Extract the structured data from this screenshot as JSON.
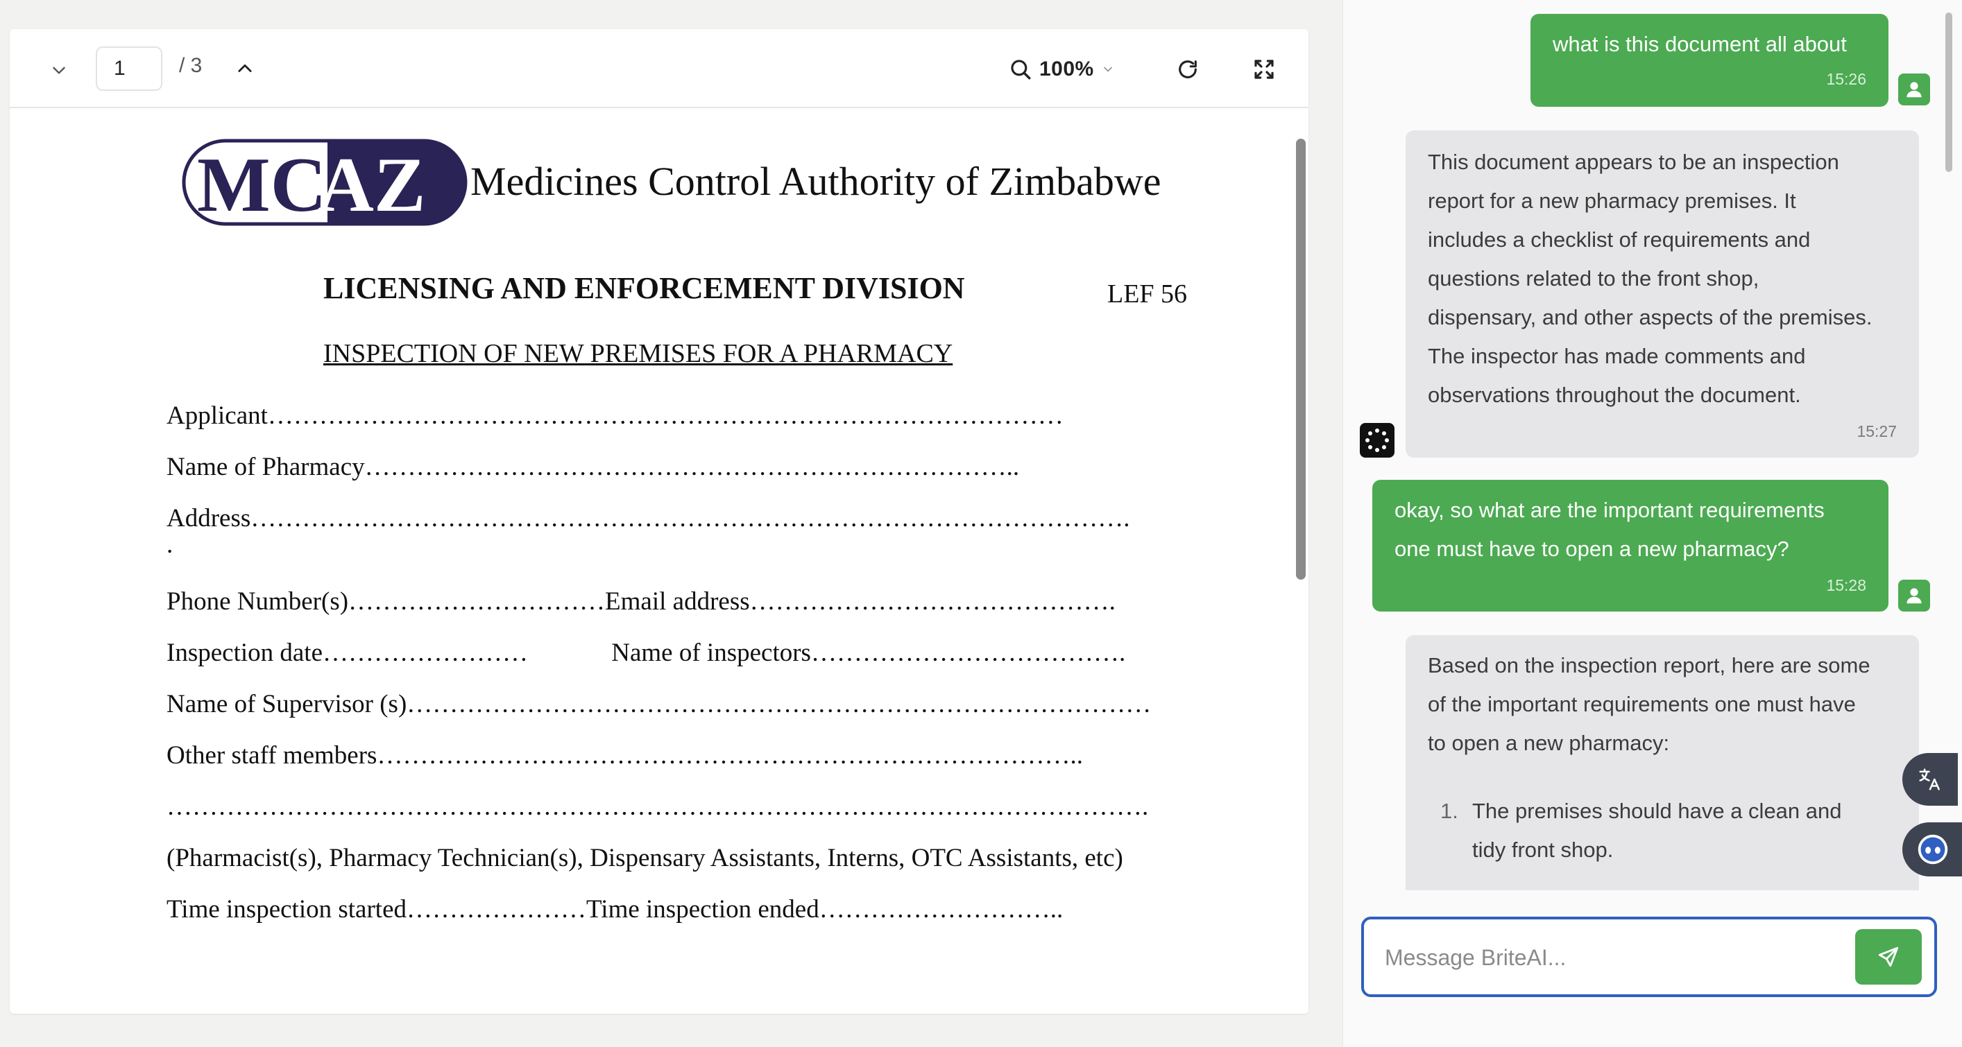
{
  "viewer": {
    "page_current": "1",
    "page_total": "/ 3",
    "zoom": "100%"
  },
  "document": {
    "logo_text_left": "MC",
    "logo_text_right": "AZ",
    "org_name": "Medicines Control Authority of Zimbabwe",
    "division": "LICENSING AND ENFORCEMENT DIVISION",
    "form_code": "LEF 56",
    "form_title": "INSPECTION OF NEW PREMISES FOR A PHARMACY",
    "fields": [
      "Applicant…………………………………………………………………………………",
      "Name of Pharmacy…………………………………………………………………..",
      "Address………………………………………………………………………………………….",
      ".",
      "Phone Number(s)…………………………Email address…………………………………….",
      "Inspection date……………………             Name of inspectors……………………………….",
      "Name of Supervisor (s)……………………………………………………………………………",
      "Other staff members………………………………………………………………………..",
      "…………………………………………………………………………………………………….",
      "(Pharmacist(s), Pharmacy Technician(s), Dispensary Assistants, Interns, OTC Assistants, etc)",
      "Time inspection started…………………Time inspection ended……………………….."
    ]
  },
  "chat": {
    "messages": [
      {
        "role": "user",
        "text": "what is this document all about",
        "time": "15:26"
      },
      {
        "role": "bot",
        "lines": [
          "This document appears to be an inspection",
          "report for a new pharmacy premises. It",
          "includes a checklist of requirements and",
          "questions related to the front shop,",
          "dispensary, and other aspects of the premises.",
          "The inspector has made comments and",
          "observations throughout the document."
        ],
        "time": "15:27"
      },
      {
        "role": "user",
        "lines": [
          "okay, so what are the important requirements",
          "one must have to open a new pharmacy?"
        ],
        "time": "15:28"
      },
      {
        "role": "bot",
        "lines": [
          "Based on the inspection report, here are some",
          "of the important requirements one must have",
          "to open a new pharmacy:"
        ],
        "list_num": "1.",
        "list_lines": [
          "The premises should have a clean and",
          "tidy front shop."
        ]
      }
    ],
    "composer_placeholder": "Message BriteAI..."
  },
  "icons": [
    "chevron-down-icon",
    "chevron-up-icon",
    "search-icon",
    "refresh-icon",
    "fullscreen-icon",
    "user-avatar-icon",
    "bot-avatar-icon",
    "translate-icon",
    "assistant-icon",
    "send-icon"
  ],
  "colors": {
    "user_bubble": "#4caa52",
    "bot_bubble": "#e6e6e8",
    "focus_border": "#2f5fc1",
    "logo_navy": "#2a2356"
  }
}
